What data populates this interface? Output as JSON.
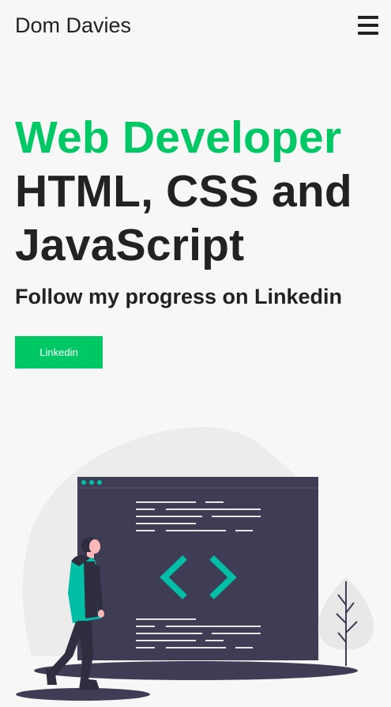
{
  "header": {
    "brand": "Dom Davies",
    "menu_icon": "hamburger-menu-icon"
  },
  "hero": {
    "headline_accent": "Web Developer",
    "headline_rest": "HTML, CSS and JavaScript",
    "subheading": "Follow my progress on Linkedin",
    "cta_label": "Linkedin"
  },
  "illustration": {
    "name": "developer-coding-illustration",
    "code_symbol": "angle-brackets-icon"
  },
  "colors": {
    "accent": "#00c864",
    "text": "#222222",
    "background": "#f7f7f7",
    "screen": "#3f3d56",
    "teal": "#00bfa6"
  }
}
